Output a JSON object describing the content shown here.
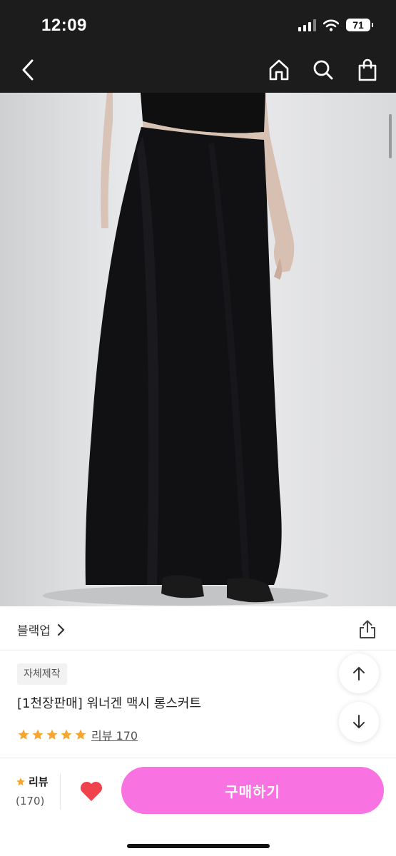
{
  "status_bar": {
    "time": "12:09",
    "battery": "71"
  },
  "brand": {
    "name": "블랙업"
  },
  "product": {
    "badge": "자체제작",
    "title": "[1천장판매] 워너겐 맥시 롱스커트",
    "rating_stars": 5,
    "review_link": "리뷰 170"
  },
  "bottom_bar": {
    "review_label": "리뷰",
    "review_count": "(170)",
    "buy_label": "구매하기"
  },
  "colors": {
    "header_bg": "#1c1c1c",
    "accent_pink": "#f872e2",
    "star": "#f7a531",
    "heart": "#f0424c"
  },
  "icons": [
    "back-icon",
    "home-icon",
    "search-icon",
    "shopping-bag-icon",
    "chevron-right-icon",
    "share-icon",
    "arrow-up-icon",
    "arrow-down-icon",
    "star-icon",
    "heart-icon"
  ]
}
